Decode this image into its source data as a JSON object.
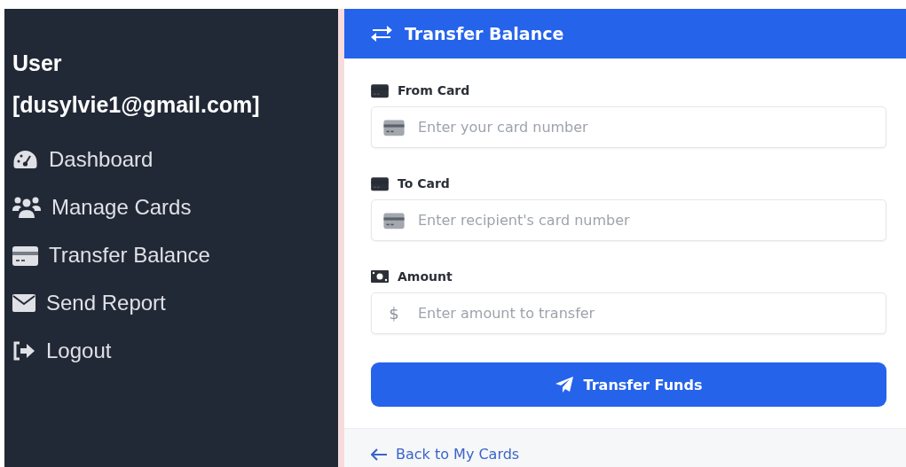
{
  "sidebar": {
    "user_label": "User",
    "user_email": "[dusylvie1@gmail.com]",
    "items": [
      {
        "label": "Dashboard"
      },
      {
        "label": "Manage Cards"
      },
      {
        "label": "Transfer Balance"
      },
      {
        "label": "Send Report"
      },
      {
        "label": "Logout"
      }
    ]
  },
  "panel": {
    "title": "Transfer Balance",
    "fields": [
      {
        "kind": "card",
        "label": "From Card",
        "placeholder": "Enter your card number"
      },
      {
        "kind": "card",
        "label": "To Card",
        "placeholder": "Enter recipient's card number"
      },
      {
        "kind": "amount",
        "label": "Amount",
        "prefix": "$",
        "placeholder": "Enter amount to transfer"
      }
    ],
    "submit": "Transfer Funds",
    "back_link": "Back to My Cards"
  }
}
